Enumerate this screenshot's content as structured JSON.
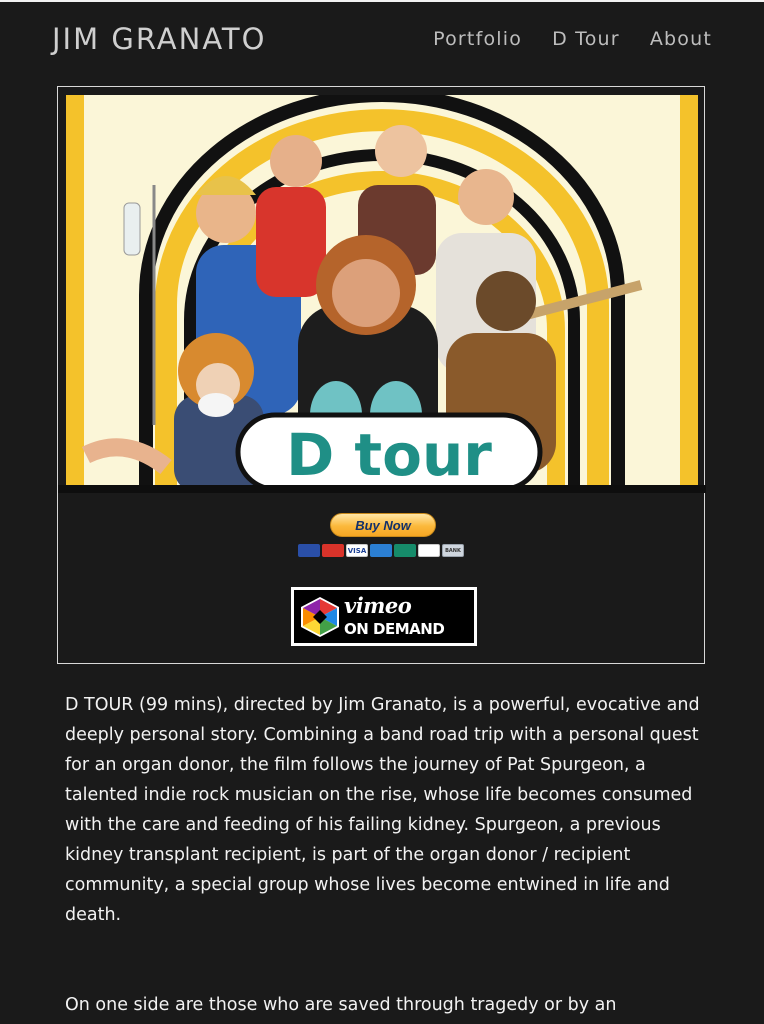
{
  "header": {
    "site_title": "JIM GRANATO",
    "nav": [
      "Portfolio",
      "D Tour",
      "About"
    ]
  },
  "feature": {
    "poster_title": "D tour",
    "buy_now_label": "Buy Now",
    "payment_cards": [
      "Maestro",
      "MasterCard",
      "VISA",
      "AMEX",
      "UnionPay",
      "DISCOVER",
      "BANK"
    ],
    "vimeo_word": "vimeo",
    "vimeo_tag": "ON DEMAND"
  },
  "body": {
    "paragraph_1": "D TOUR (99 mins), directed by Jim Granato, is a powerful, evocative and deeply personal story. Combining a band road trip with a personal quest for an organ donor, the film follows the journey of Pat Spurgeon, a talented indie rock musician on the rise, whose life becomes consumed with the care and feeding of his failing kidney. Spurgeon, a previous kidney transplant recipient, is part of the organ donor / recipient community, a special group whose lives become entwined in life and death.",
    "paragraph_2": "On one side are those who are saved through tragedy or by an"
  },
  "colors": {
    "background": "#1a1a1a",
    "text": "#f2f2f2",
    "nav": "#bdbdbd",
    "poster_yellow": "#f4c22b",
    "poster_teal": "#1f8f86",
    "paypal_orange": "#fbb93c"
  }
}
